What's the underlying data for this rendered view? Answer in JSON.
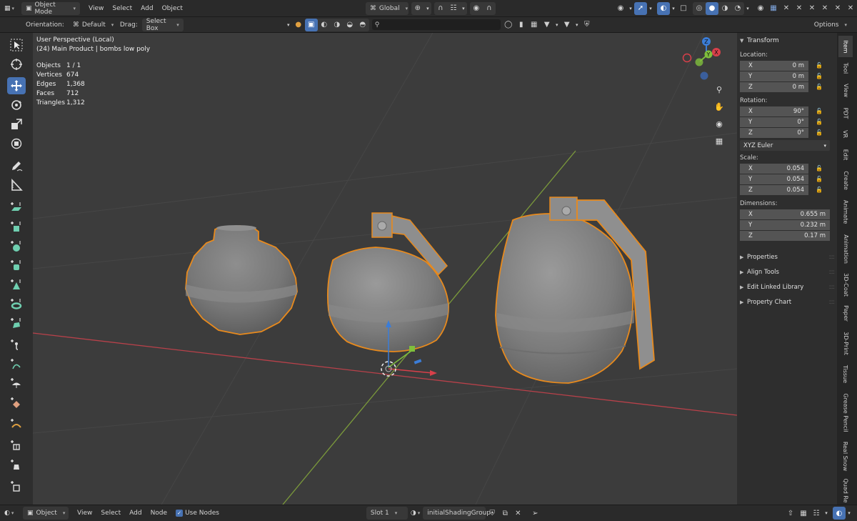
{
  "header": {
    "mode": "Object Mode",
    "menus": [
      "View",
      "Select",
      "Add",
      "Object"
    ],
    "transform_orientation": "Global",
    "options_label": "Options"
  },
  "tool_settings": {
    "orientation_label": "Orientation:",
    "orientation_value": "Default",
    "drag_label": "Drag:",
    "drag_value": "Select Box",
    "search_value": ""
  },
  "viewport": {
    "view_name": "User Perspective (Local)",
    "collection": "(24) Main Product | bombs low poly",
    "stats": [
      {
        "label": "Objects",
        "value": "1 / 1"
      },
      {
        "label": "Vertices",
        "value": "674"
      },
      {
        "label": "Edges",
        "value": "1,368"
      },
      {
        "label": "Faces",
        "value": "712"
      },
      {
        "label": "Triangles",
        "value": "1,312"
      }
    ],
    "gizmo_axes": {
      "x": "X",
      "y": "Y",
      "z": "Z"
    }
  },
  "npanel": {
    "transform_title": "Transform",
    "location_label": "Location:",
    "location": [
      {
        "axis": "X",
        "value": "0 m"
      },
      {
        "axis": "Y",
        "value": "0 m"
      },
      {
        "axis": "Z",
        "value": "0 m"
      }
    ],
    "rotation_label": "Rotation:",
    "rotation": [
      {
        "axis": "X",
        "value": "90°"
      },
      {
        "axis": "Y",
        "value": "0°"
      },
      {
        "axis": "Z",
        "value": "0°"
      }
    ],
    "rotation_mode": "XYZ Euler",
    "scale_label": "Scale:",
    "scale": [
      {
        "axis": "X",
        "value": "0.054"
      },
      {
        "axis": "Y",
        "value": "0.054"
      },
      {
        "axis": "Z",
        "value": "0.054"
      }
    ],
    "dimensions_label": "Dimensions:",
    "dimensions": [
      {
        "axis": "X",
        "value": "0.655 m"
      },
      {
        "axis": "Y",
        "value": "0.232 m"
      },
      {
        "axis": "Z",
        "value": "0.17 m"
      }
    ],
    "collapsed_panels": [
      "Properties",
      "Align Tools",
      "Edit Linked Library",
      "Property Chart"
    ]
  },
  "tabs": [
    "Item",
    "Tool",
    "View",
    "PDT",
    "VR",
    "Edit",
    "Create",
    "Animate",
    "Animation",
    "3D-Coat",
    "Paper",
    "3D-Print",
    "Tissue",
    "Grease Pencil",
    "Real Snow",
    "Quad Re"
  ],
  "bottom": {
    "editor_type": "Object",
    "menus": [
      "View",
      "Select",
      "Add",
      "Node"
    ],
    "use_nodes_label": "Use Nodes",
    "slot": "Slot 1",
    "material": "initialShadingGroup"
  }
}
